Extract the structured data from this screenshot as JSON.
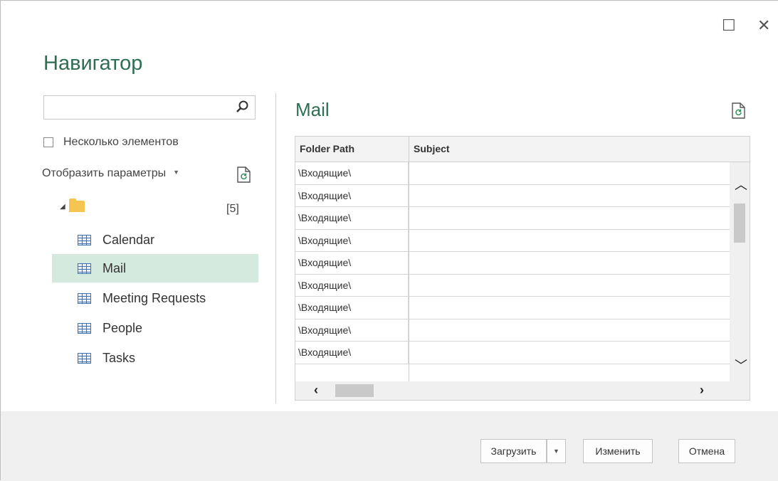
{
  "window": {
    "title": "Навигатор",
    "maximize_glyph": "☐",
    "close_glyph": "✕"
  },
  "sidebar": {
    "search_placeholder": "",
    "multi_select_label": "Несколько элементов",
    "display_options_label": "Отобразить параметры",
    "root_count": "[5]",
    "items": [
      {
        "label": "Calendar",
        "selected": false
      },
      {
        "label": "Mail",
        "selected": true
      },
      {
        "label": "Meeting Requests",
        "selected": false
      },
      {
        "label": "People",
        "selected": false
      },
      {
        "label": "Tasks",
        "selected": false
      }
    ]
  },
  "preview": {
    "title": "Mail",
    "columns": [
      "Folder Path",
      "Subject"
    ],
    "rows": [
      "\\Входящие\\",
      "\\Входящие\\",
      "\\Входящие\\",
      "\\Входящие\\",
      "\\Входящие\\",
      "\\Входящие\\",
      "\\Входящие\\",
      "\\Входящие\\",
      "\\Входящие\\"
    ]
  },
  "footer": {
    "load_label": "Загрузить",
    "edit_label": "Изменить",
    "cancel_label": "Отмена"
  },
  "colors": {
    "accent": "#2e6e52",
    "selection": "#d5eadf"
  }
}
